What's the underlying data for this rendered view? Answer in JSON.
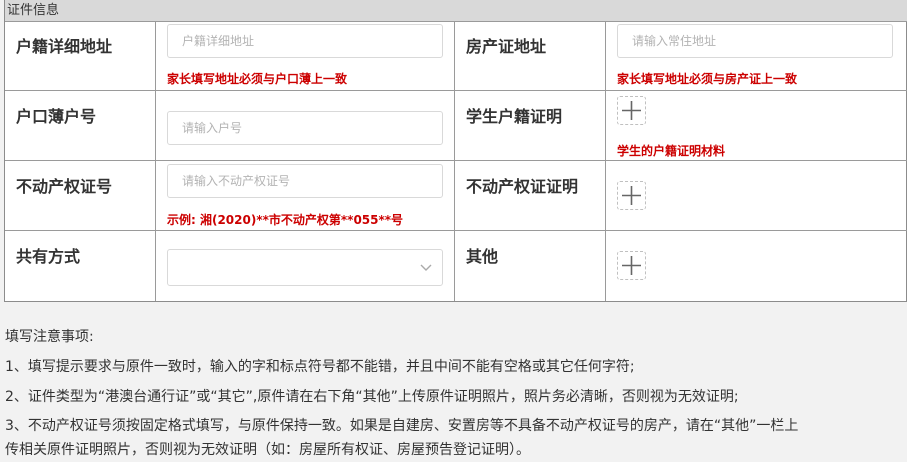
{
  "section_title": "证件信息",
  "fields": {
    "address": {
      "label": "户籍详细地址",
      "placeholder": "户籍详细地址",
      "hint": "家长填写地址必须与户口薄上一致"
    },
    "property_address": {
      "label": "房产证地址",
      "placeholder": "请输入常住地址",
      "hint": "家长填写地址必须与房产证上一致"
    },
    "hukou_no": {
      "label": "户口薄户号",
      "placeholder": "请输入户号"
    },
    "student_hukou_proof": {
      "label": "学生户籍证明",
      "hint": "学生的户籍证明材料"
    },
    "property_cert_no": {
      "label": "不动产权证号",
      "placeholder": "请输入不动产权证号",
      "hint": "示例: 湘(2020)**市不动产权第**055**号"
    },
    "property_cert_proof": {
      "label": "不动产权证证明"
    },
    "ownership": {
      "label": "共有方式",
      "value": ""
    },
    "other": {
      "label": "其他"
    }
  },
  "notes": {
    "title": "填写注意事项:",
    "items": [
      "1、填写提示要求与原件一致时，输入的字和标点符号都不能错，并且中间不能有空格或其它任何字符;",
      "2、证件类型为“港澳台通行证”或“其它”,原件请在右下角“其他”上传原件证明照片，照片务必清晰，否则视为无效证明;",
      "3、不动产权证号须按固定格式填写，与原件保持一致。如果是自建房、安置房等不具备不动产权证号的房产，请在“其他”一栏上",
      "传相关原件证明照片，否则视为无效证明（如：房屋所有权证、房屋预告登记证明）。"
    ]
  },
  "icons": {
    "upload": "plus-icon",
    "select": "chevron-down-icon"
  },
  "colors": {
    "hint": "#cc0000",
    "header_bg": "#d9d9d9",
    "page_bg": "#f2f2f2"
  }
}
